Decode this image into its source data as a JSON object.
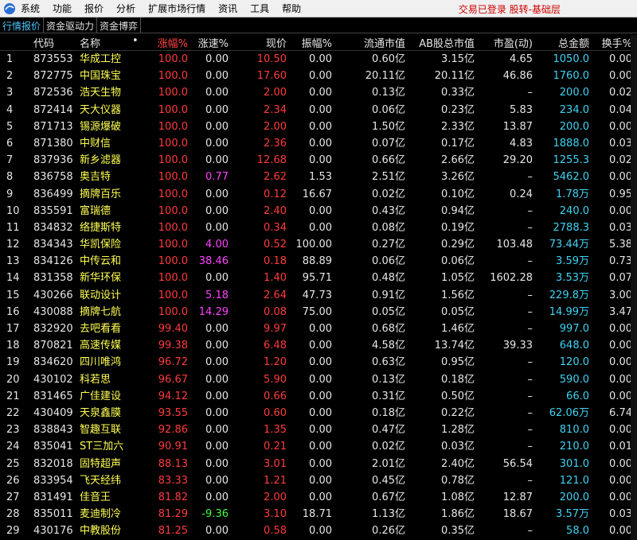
{
  "menu": {
    "items": [
      "系统",
      "功能",
      "报价",
      "分析",
      "扩展市场行情",
      "资讯",
      "工具",
      "帮助"
    ],
    "status": "交易已登录  股转-基础层"
  },
  "tabs": [
    "行情报价",
    "资金驱动力",
    "资金博弈"
  ],
  "columns": {
    "code": "代码",
    "name": "名称",
    "sort_marker": "•",
    "chg": "涨幅%",
    "speed": "涨速%",
    "price": "现价",
    "amplitude": "振幅%",
    "float_cap": "流通市值",
    "ab_cap": "AB股总市值",
    "pe": "市盈(动)",
    "amount": "总金额",
    "turnover": "换手%"
  },
  "rows": [
    {
      "idx": "1",
      "code": "873553",
      "name": "华成工控",
      "chg": "100.0",
      "speed": "0.00",
      "price": "10.50",
      "amp": "0.00",
      "float": "0.60亿",
      "ab": "3.15亿",
      "pe": "4.65",
      "amt": "1050.0",
      "turn": "0.00"
    },
    {
      "idx": "2",
      "code": "872775",
      "name": "中国珠宝",
      "chg": "100.0",
      "speed": "0.00",
      "price": "17.60",
      "amp": "0.00",
      "float": "20.11亿",
      "ab": "20.11亿",
      "pe": "46.86",
      "amt": "1760.0",
      "turn": "0.00"
    },
    {
      "idx": "3",
      "code": "872536",
      "name": "浩天生物",
      "chg": "100.0",
      "speed": "0.00",
      "price": "2.00",
      "amp": "0.00",
      "float": "0.13亿",
      "ab": "0.33亿",
      "pe": "–",
      "amt": "200.0",
      "turn": "0.02"
    },
    {
      "idx": "4",
      "code": "872414",
      "name": "天大仪器",
      "chg": "100.0",
      "speed": "0.00",
      "price": "2.34",
      "amp": "0.00",
      "float": "0.06亿",
      "ab": "0.23亿",
      "pe": "5.83",
      "amt": "234.0",
      "turn": "0.04"
    },
    {
      "idx": "5",
      "code": "871713",
      "name": "锡源爆破",
      "chg": "100.0",
      "speed": "0.00",
      "price": "2.00",
      "amp": "0.00",
      "float": "1.50亿",
      "ab": "2.33亿",
      "pe": "13.87",
      "amt": "200.0",
      "turn": "0.00"
    },
    {
      "idx": "6",
      "code": "871380",
      "name": "中财信",
      "chg": "100.0",
      "speed": "0.00",
      "price": "2.36",
      "amp": "0.00",
      "float": "0.07亿",
      "ab": "0.17亿",
      "pe": "4.83",
      "amt": "1888.0",
      "turn": "0.03"
    },
    {
      "idx": "7",
      "code": "837936",
      "name": "新乡滤器",
      "chg": "100.0",
      "speed": "0.00",
      "price": "12.68",
      "amp": "0.00",
      "float": "0.66亿",
      "ab": "2.66亿",
      "pe": "29.20",
      "amt": "1255.3",
      "turn": "0.02"
    },
    {
      "idx": "8",
      "code": "836758",
      "name": "奥吉特",
      "chg": "100.0",
      "speed": "0.77",
      "price": "2.62",
      "amp": "1.53",
      "float": "2.51亿",
      "ab": "3.26亿",
      "pe": "–",
      "amt": "5462.0",
      "turn": "0.00"
    },
    {
      "idx": "9",
      "code": "836499",
      "name": "摘牌百乐",
      "chg": "100.0",
      "speed": "0.00",
      "price": "0.12",
      "amp": "16.67",
      "float": "0.02亿",
      "ab": "0.10亿",
      "pe": "0.24",
      "amt": "1.78万",
      "turn": "0.95"
    },
    {
      "idx": "10",
      "code": "835591",
      "name": "富瑞德",
      "chg": "100.0",
      "speed": "0.00",
      "price": "2.40",
      "amp": "0.00",
      "float": "0.43亿",
      "ab": "0.94亿",
      "pe": "–",
      "amt": "240.0",
      "turn": "0.00"
    },
    {
      "idx": "11",
      "code": "834832",
      "name": "络捷斯特",
      "chg": "100.0",
      "speed": "0.00",
      "price": "0.34",
      "amp": "0.00",
      "float": "0.08亿",
      "ab": "0.19亿",
      "pe": "–",
      "amt": "2788.3",
      "turn": "0.03"
    },
    {
      "idx": "12",
      "code": "834343",
      "name": "华凯保险",
      "chg": "100.0",
      "speed": "4.00",
      "price": "0.52",
      "amp": "100.00",
      "float": "0.27亿",
      "ab": "0.29亿",
      "pe": "103.48",
      "amt": "73.44万",
      "turn": "5.38"
    },
    {
      "idx": "13",
      "code": "834126",
      "name": "中传云和",
      "chg": "100.0",
      "speed": "38.46",
      "price": "0.18",
      "amp": "88.89",
      "float": "0.06亿",
      "ab": "0.06亿",
      "pe": "–",
      "amt": "3.59万",
      "turn": "0.73"
    },
    {
      "idx": "14",
      "code": "831358",
      "name": "新华环保",
      "chg": "100.0",
      "speed": "0.00",
      "price": "1.40",
      "amp": "95.71",
      "float": "0.48亿",
      "ab": "1.05亿",
      "pe": "1602.28",
      "amt": "3.53万",
      "turn": "0.07"
    },
    {
      "idx": "15",
      "code": "430266",
      "name": "联动设计",
      "chg": "100.0",
      "speed": "5.18",
      "price": "2.64",
      "amp": "47.73",
      "float": "0.91亿",
      "ab": "1.56亿",
      "pe": "–",
      "amt": "229.8万",
      "turn": "3.00"
    },
    {
      "idx": "16",
      "code": "430088",
      "name": "摘牌七航",
      "chg": "100.0",
      "speed": "14.29",
      "price": "0.08",
      "amp": "75.00",
      "float": "0.05亿",
      "ab": "0.05亿",
      "pe": "–",
      "amt": "14.99万",
      "turn": "3.47"
    },
    {
      "idx": "17",
      "code": "832920",
      "name": "去吧看看",
      "chg": "99.40",
      "speed": "0.00",
      "price": "9.97",
      "amp": "0.00",
      "float": "0.68亿",
      "ab": "1.46亿",
      "pe": "–",
      "amt": "997.0",
      "turn": "0.00"
    },
    {
      "idx": "18",
      "code": "870821",
      "name": "高速传媒",
      "chg": "99.38",
      "speed": "0.00",
      "price": "6.48",
      "amp": "0.00",
      "float": "4.58亿",
      "ab": "13.74亿",
      "pe": "39.33",
      "amt": "648.0",
      "turn": "0.00"
    },
    {
      "idx": "19",
      "code": "834620",
      "name": "四川唯鸿",
      "chg": "96.72",
      "speed": "0.00",
      "price": "1.20",
      "amp": "0.00",
      "float": "0.63亿",
      "ab": "0.95亿",
      "pe": "–",
      "amt": "120.0",
      "turn": "0.00"
    },
    {
      "idx": "20",
      "code": "430102",
      "name": "科若思",
      "chg": "96.67",
      "speed": "0.00",
      "price": "5.90",
      "amp": "0.00",
      "float": "0.13亿",
      "ab": "0.18亿",
      "pe": "–",
      "amt": "590.0",
      "turn": "0.00"
    },
    {
      "idx": "21",
      "code": "831465",
      "name": "广佳建设",
      "chg": "94.12",
      "speed": "0.00",
      "price": "0.66",
      "amp": "0.00",
      "float": "0.31亿",
      "ab": "0.50亿",
      "pe": "–",
      "amt": "66.0",
      "turn": "0.00"
    },
    {
      "idx": "22",
      "code": "430409",
      "name": "天泉鑫膜",
      "chg": "93.55",
      "speed": "0.00",
      "price": "0.60",
      "amp": "0.00",
      "float": "0.18亿",
      "ab": "0.22亿",
      "pe": "–",
      "amt": "62.06万",
      "turn": "6.74"
    },
    {
      "idx": "23",
      "code": "838843",
      "name": "智趣互联",
      "chg": "92.86",
      "speed": "0.00",
      "price": "1.35",
      "amp": "0.00",
      "float": "0.47亿",
      "ab": "1.28亿",
      "pe": "–",
      "amt": "810.0",
      "turn": "0.00"
    },
    {
      "idx": "24",
      "code": "835041",
      "name": "ST三加六",
      "chg": "90.91",
      "speed": "0.00",
      "price": "0.21",
      "amp": "0.00",
      "float": "0.02亿",
      "ab": "0.03亿",
      "pe": "–",
      "amt": "210.0",
      "turn": "0.01"
    },
    {
      "idx": "25",
      "code": "832018",
      "name": "固特超声",
      "chg": "88.13",
      "speed": "0.00",
      "price": "3.01",
      "amp": "0.00",
      "float": "2.01亿",
      "ab": "2.40亿",
      "pe": "56.54",
      "amt": "301.0",
      "turn": "0.00"
    },
    {
      "idx": "26",
      "code": "833954",
      "name": "飞天经纬",
      "chg": "83.33",
      "speed": "0.00",
      "price": "1.21",
      "amp": "0.00",
      "float": "0.45亿",
      "ab": "0.78亿",
      "pe": "–",
      "amt": "121.0",
      "turn": "0.00"
    },
    {
      "idx": "27",
      "code": "831491",
      "name": "佳音王",
      "chg": "81.82",
      "speed": "0.00",
      "price": "2.00",
      "amp": "0.00",
      "float": "0.67亿",
      "ab": "1.08亿",
      "pe": "12.87",
      "amt": "200.0",
      "turn": "0.00"
    },
    {
      "idx": "28",
      "code": "835011",
      "name": "麦迪制冷",
      "chg": "81.29",
      "speed": "-9.36",
      "price": "3.10",
      "amp": "18.71",
      "float": "1.13亿",
      "ab": "1.86亿",
      "pe": "18.67",
      "amt": "3.57万",
      "turn": "0.03"
    },
    {
      "idx": "29",
      "code": "430176",
      "name": "中教股份",
      "chg": "81.25",
      "speed": "0.00",
      "price": "0.58",
      "amp": "0.00",
      "float": "0.26亿",
      "ab": "0.35亿",
      "pe": "–",
      "amt": "58.0",
      "turn": "0.00"
    }
  ],
  "colors": {
    "up": "#ff3b3b",
    "down": "#3cff3c",
    "neutral": "#e6e6e6",
    "name": "#ffff54",
    "amount": "#3fd3f2",
    "speed_highlight": "#ff40ff",
    "background": "#000000"
  }
}
